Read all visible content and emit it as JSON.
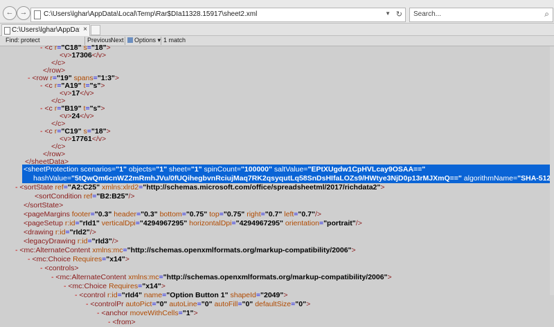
{
  "toolbar": {
    "back_glyph": "←",
    "forward_glyph": "→",
    "address": "C:\\Users\\lghar\\AppData\\Local\\Temp\\Rar$DIa11328.15917\\sheet2.xml",
    "dropdown_glyph": "▼",
    "refresh_glyph": "↻",
    "search_placeholder": "Search...",
    "search_icon": "⌕"
  },
  "tab": {
    "title": "C:\\Users\\lghar\\AppData\\Loc...",
    "close_glyph": "×"
  },
  "find": {
    "label": "Find:",
    "value": "protect",
    "previous": "Previous",
    "next": "Next",
    "options": "Options",
    "options_arrow": "▾",
    "match": "1 match"
  },
  "xml": [
    {
      "id": "l01",
      "parts": [
        [
          "dash",
          "- "
        ],
        [
          "tg",
          "<c "
        ],
        [
          "an",
          "r"
        ],
        [
          "eq",
          "="
        ],
        [
          "av",
          "\"C18\" "
        ],
        [
          "an",
          "s"
        ],
        [
          "eq",
          "="
        ],
        [
          "av",
          "\"18\""
        ],
        [
          "tg",
          ">"
        ]
      ]
    },
    {
      "id": "l02",
      "parts": [
        [
          "tg",
          "<v>"
        ],
        [
          "tx",
          "17306"
        ],
        [
          "tg",
          "</v>"
        ]
      ]
    },
    {
      "id": "l03",
      "parts": [
        [
          "tg",
          "</c>"
        ]
      ]
    },
    {
      "id": "l04",
      "parts": [
        [
          "tg",
          "</row>"
        ]
      ]
    },
    {
      "id": "l05",
      "parts": [
        [
          "dash",
          "- "
        ],
        [
          "tg",
          "<row "
        ],
        [
          "an",
          "r"
        ],
        [
          "eq",
          "="
        ],
        [
          "av",
          "\"19\" "
        ],
        [
          "an",
          "spans"
        ],
        [
          "eq",
          "="
        ],
        [
          "av",
          "\"1:3\""
        ],
        [
          "tg",
          ">"
        ]
      ]
    },
    {
      "id": "l06",
      "parts": [
        [
          "dash",
          "- "
        ],
        [
          "tg",
          "<c "
        ],
        [
          "an",
          "r"
        ],
        [
          "eq",
          "="
        ],
        [
          "av",
          "\"A19\" "
        ],
        [
          "an",
          "t"
        ],
        [
          "eq",
          "="
        ],
        [
          "av",
          "\"s\""
        ],
        [
          "tg",
          ">"
        ]
      ]
    },
    {
      "id": "l07",
      "parts": [
        [
          "tg",
          "<v>"
        ],
        [
          "tx",
          "17"
        ],
        [
          "tg",
          "</v>"
        ]
      ]
    },
    {
      "id": "l08",
      "parts": [
        [
          "tg",
          "</c>"
        ]
      ]
    },
    {
      "id": "l09",
      "parts": [
        [
          "dash",
          "- "
        ],
        [
          "tg",
          "<c "
        ],
        [
          "an",
          "r"
        ],
        [
          "eq",
          "="
        ],
        [
          "av",
          "\"B19\" "
        ],
        [
          "an",
          "t"
        ],
        [
          "eq",
          "="
        ],
        [
          "av",
          "\"s\""
        ],
        [
          "tg",
          ">"
        ]
      ]
    },
    {
      "id": "l10",
      "parts": [
        [
          "tg",
          "<v>"
        ],
        [
          "tx",
          "24"
        ],
        [
          "tg",
          "</v>"
        ]
      ]
    },
    {
      "id": "l11",
      "parts": [
        [
          "tg",
          "</c>"
        ]
      ]
    },
    {
      "id": "l12",
      "parts": [
        [
          "dash",
          "- "
        ],
        [
          "tg",
          "<c "
        ],
        [
          "an",
          "r"
        ],
        [
          "eq",
          "="
        ],
        [
          "av",
          "\"C19\" "
        ],
        [
          "an",
          "s"
        ],
        [
          "eq",
          "="
        ],
        [
          "av",
          "\"18\""
        ],
        [
          "tg",
          ">"
        ]
      ]
    },
    {
      "id": "l13",
      "parts": [
        [
          "tg",
          "<v>"
        ],
        [
          "tx",
          "17761"
        ],
        [
          "tg",
          "</v>"
        ]
      ]
    },
    {
      "id": "l14",
      "parts": [
        [
          "tg",
          "</c>"
        ]
      ]
    },
    {
      "id": "l15",
      "parts": [
        [
          "tg",
          "</row>"
        ]
      ]
    },
    {
      "id": "l16",
      "parts": [
        [
          "tg",
          "</sheetData>"
        ]
      ]
    },
    {
      "id": "l17",
      "parts": [
        [
          "tg",
          "<"
        ],
        [
          "tg",
          "sheetProtection "
        ],
        [
          "an",
          "scenarios"
        ],
        [
          "eq",
          "="
        ],
        [
          "av",
          "\"1\" "
        ],
        [
          "an",
          "objects"
        ],
        [
          "eq",
          "="
        ],
        [
          "av",
          "\"1\" "
        ],
        [
          "an",
          "sheet"
        ],
        [
          "eq",
          "="
        ],
        [
          "av",
          "\"1\" "
        ],
        [
          "an",
          "spinCount"
        ],
        [
          "eq",
          "="
        ],
        [
          "av",
          "\"100000\" "
        ],
        [
          "an",
          "saltValue"
        ],
        [
          "eq",
          "="
        ],
        [
          "av",
          "\"EPtXUgdw1CpHVLcay9OSAA==\""
        ]
      ]
    },
    {
      "id": "l18",
      "parts": [
        [
          "an",
          "hashValue"
        ],
        [
          "eq",
          "="
        ],
        [
          "av",
          "\"5tQwQm6cnWZ2mRmhJVu/0fUQihegbvnRciujMaq7RK2qsyqutLq58SnDsHIfaLOZs9/HWtye3NjD0p13rMJXmQ==\" "
        ],
        [
          "an",
          "algorithmName"
        ],
        [
          "eq",
          "="
        ],
        [
          "av",
          "\"SHA-512\""
        ],
        [
          "tg",
          "/>"
        ]
      ]
    },
    {
      "id": "l19",
      "parts": [
        [
          "dash",
          "- "
        ],
        [
          "tg",
          "<sortState "
        ],
        [
          "an",
          "ref"
        ],
        [
          "eq",
          "="
        ],
        [
          "av",
          "\"A2:C25\" "
        ],
        [
          "an",
          "xmlns:xlrd2"
        ],
        [
          "eq",
          "="
        ],
        [
          "av",
          "\"http://schemas.microsoft.com/office/spreadsheetml/2017/richdata2\""
        ],
        [
          "tg",
          ">"
        ]
      ]
    },
    {
      "id": "l20",
      "parts": [
        [
          "tg",
          "<sortCondition "
        ],
        [
          "an",
          "ref"
        ],
        [
          "eq",
          "="
        ],
        [
          "av",
          "\"B2:B25\""
        ],
        [
          "tg",
          "/>"
        ]
      ]
    },
    {
      "id": "l21",
      "parts": [
        [
          "tg",
          "</sortState>"
        ]
      ]
    },
    {
      "id": "l22",
      "parts": [
        [
          "tg",
          "<pageMargins "
        ],
        [
          "an",
          "footer"
        ],
        [
          "eq",
          "="
        ],
        [
          "av",
          "\"0.3\" "
        ],
        [
          "an",
          "header"
        ],
        [
          "eq",
          "="
        ],
        [
          "av",
          "\"0.3\" "
        ],
        [
          "an",
          "bottom"
        ],
        [
          "eq",
          "="
        ],
        [
          "av",
          "\"0.75\" "
        ],
        [
          "an",
          "top"
        ],
        [
          "eq",
          "="
        ],
        [
          "av",
          "\"0.75\" "
        ],
        [
          "an",
          "right"
        ],
        [
          "eq",
          "="
        ],
        [
          "av",
          "\"0.7\" "
        ],
        [
          "an",
          "left"
        ],
        [
          "eq",
          "="
        ],
        [
          "av",
          "\"0.7\""
        ],
        [
          "tg",
          "/>"
        ]
      ]
    },
    {
      "id": "l23",
      "parts": [
        [
          "tg",
          "<pageSetup "
        ],
        [
          "an",
          "r:id"
        ],
        [
          "eq",
          "="
        ],
        [
          "av",
          "\"rId1\" "
        ],
        [
          "an",
          "verticalDpi"
        ],
        [
          "eq",
          "="
        ],
        [
          "av",
          "\"4294967295\" "
        ],
        [
          "an",
          "horizontalDpi"
        ],
        [
          "eq",
          "="
        ],
        [
          "av",
          "\"4294967295\" "
        ],
        [
          "an",
          "orientation"
        ],
        [
          "eq",
          "="
        ],
        [
          "av",
          "\"portrait\""
        ],
        [
          "tg",
          "/>"
        ]
      ]
    },
    {
      "id": "l24",
      "parts": [
        [
          "tg",
          "<drawing "
        ],
        [
          "an",
          "r:id"
        ],
        [
          "eq",
          "="
        ],
        [
          "av",
          "\"rId2\""
        ],
        [
          "tg",
          "/>"
        ]
      ]
    },
    {
      "id": "l25",
      "parts": [
        [
          "tg",
          "<legacyDrawing "
        ],
        [
          "an",
          "r:id"
        ],
        [
          "eq",
          "="
        ],
        [
          "av",
          "\"rId3\""
        ],
        [
          "tg",
          "/>"
        ]
      ]
    },
    {
      "id": "l26",
      "parts": [
        [
          "dash",
          "- "
        ],
        [
          "tg",
          "<mc:AlternateContent "
        ],
        [
          "an",
          "xmlns:mc"
        ],
        [
          "eq",
          "="
        ],
        [
          "av",
          "\"http://schemas.openxmlformats.org/markup-compatibility/2006\""
        ],
        [
          "tg",
          ">"
        ]
      ]
    },
    {
      "id": "l27",
      "parts": [
        [
          "dash",
          "- "
        ],
        [
          "tg",
          "<mc:Choice "
        ],
        [
          "an",
          "Requires"
        ],
        [
          "eq",
          "="
        ],
        [
          "av",
          "\"x14\""
        ],
        [
          "tg",
          ">"
        ]
      ]
    },
    {
      "id": "l28",
      "parts": [
        [
          "dash",
          "- "
        ],
        [
          "tg",
          "<controls>"
        ]
      ]
    },
    {
      "id": "l29",
      "parts": [
        [
          "dash",
          "- "
        ],
        [
          "tg",
          "<mc:AlternateContent "
        ],
        [
          "an",
          "xmlns:mc"
        ],
        [
          "eq",
          "="
        ],
        [
          "av",
          "\"http://schemas.openxmlformats.org/markup-compatibility/2006\""
        ],
        [
          "tg",
          ">"
        ]
      ]
    },
    {
      "id": "l30",
      "parts": [
        [
          "dash",
          "- "
        ],
        [
          "tg",
          "<mc:Choice "
        ],
        [
          "an",
          "Requires"
        ],
        [
          "eq",
          "="
        ],
        [
          "av",
          "\"x14\""
        ],
        [
          "tg",
          ">"
        ]
      ]
    },
    {
      "id": "l31",
      "parts": [
        [
          "dash",
          "- "
        ],
        [
          "tg",
          "<control "
        ],
        [
          "an",
          "r:id"
        ],
        [
          "eq",
          "="
        ],
        [
          "av",
          "\"rId4\" "
        ],
        [
          "an",
          "name"
        ],
        [
          "eq",
          "="
        ],
        [
          "av",
          "\"Option Button 1\" "
        ],
        [
          "an",
          "shapeId"
        ],
        [
          "eq",
          "="
        ],
        [
          "av",
          "\"2049\""
        ],
        [
          "tg",
          ">"
        ]
      ]
    },
    {
      "id": "l32",
      "parts": [
        [
          "dash",
          "- "
        ],
        [
          "tg",
          "<controlPr "
        ],
        [
          "an",
          "autoPict"
        ],
        [
          "eq",
          "="
        ],
        [
          "av",
          "\"0\" "
        ],
        [
          "an",
          "autoLine"
        ],
        [
          "eq",
          "="
        ],
        [
          "av",
          "\"0\" "
        ],
        [
          "an",
          "autoFill"
        ],
        [
          "eq",
          "="
        ],
        [
          "av",
          "\"0\" "
        ],
        [
          "an",
          "defaultSize"
        ],
        [
          "eq",
          "="
        ],
        [
          "av",
          "\"0\""
        ],
        [
          "tg",
          ">"
        ]
      ]
    },
    {
      "id": "l33",
      "parts": [
        [
          "dash",
          "- "
        ],
        [
          "tg",
          "<anchor "
        ],
        [
          "an",
          "moveWithCells"
        ],
        [
          "eq",
          "="
        ],
        [
          "av",
          "\"1\""
        ],
        [
          "tg",
          ">"
        ]
      ]
    },
    {
      "id": "l34",
      "parts": [
        [
          "dash",
          "- "
        ],
        [
          "tg",
          "<from>"
        ]
      ]
    }
  ]
}
